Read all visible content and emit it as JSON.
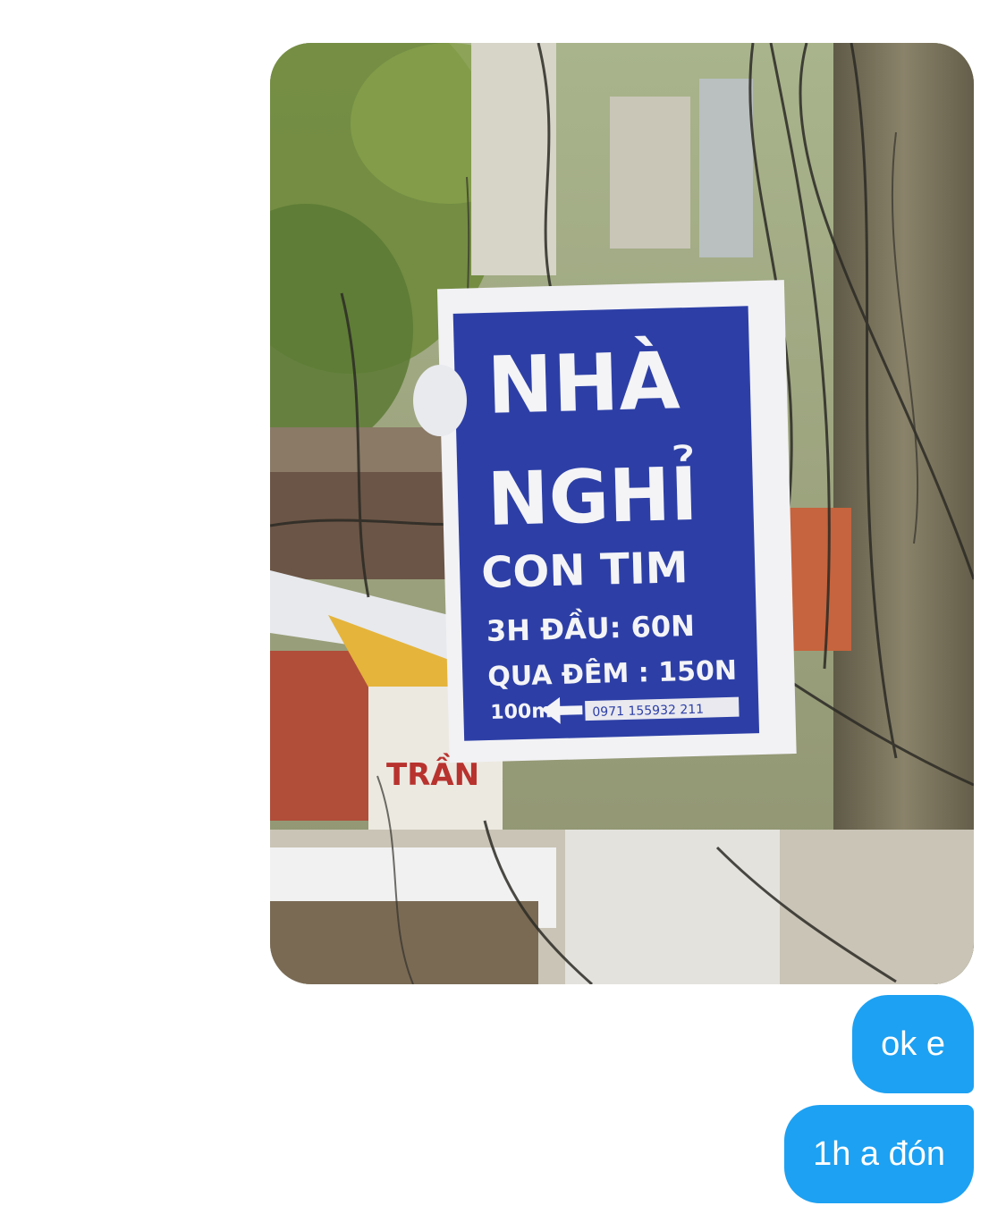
{
  "conversation": {
    "photo": {
      "sign": {
        "line1": "NHÀ",
        "line2": "NGHỈ",
        "line3": "CON TIM",
        "line4": "3H ĐẦU: 60N",
        "line5": "QUA ĐÊM : 150N",
        "line6": "100m",
        "phone": "0971 155932 211",
        "banner_fragment": "TRẦN"
      },
      "colors": {
        "sign_blue": "#2d3fa6",
        "sign_border": "#f2f2f5",
        "pole": "#7b7660",
        "foliage": "#6f8a3c"
      }
    },
    "messages": [
      {
        "text": "ok e",
        "sender": "me"
      },
      {
        "text": "1h a đón",
        "sender": "me"
      }
    ],
    "colors": {
      "bubble": "#1da1f2",
      "bubble_text": "#ffffff"
    }
  }
}
